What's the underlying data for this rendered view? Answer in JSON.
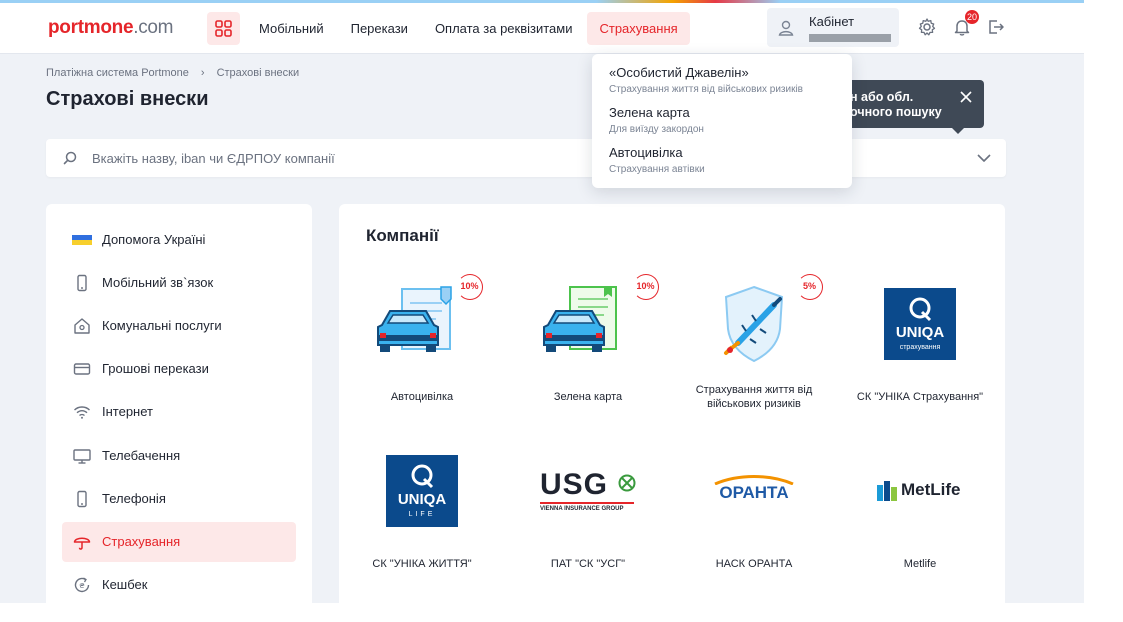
{
  "brand": {
    "logo_part1": "portmone",
    "logo_part2": ".com"
  },
  "nav": {
    "items": [
      "Мобільний",
      "Перекази",
      "Оплата за реквізитами",
      "Страхування"
    ],
    "active_index": 3
  },
  "header": {
    "cabinet_label": "Кабінет",
    "notifications_count": "20"
  },
  "breadcrumb": {
    "items": [
      "Платіжна система Portmone",
      "Страхові внески"
    ]
  },
  "page": {
    "title": "Страхові внески"
  },
  "search": {
    "placeholder": "Вкажіть назву, iban чи ЄДРПОУ компанії"
  },
  "tooltip": {
    "line1": "н або обл.",
    "line2": "очного пошуку"
  },
  "dropdown": {
    "items": [
      {
        "title": "«Особистий Джавелін»",
        "subtitle": "Страхування життя від військових ризиків"
      },
      {
        "title": "Зелена карта",
        "subtitle": "Для виїзду закордон"
      },
      {
        "title": "Автоцивілка",
        "subtitle": "Страхування автівки"
      }
    ]
  },
  "sidebar": {
    "items": [
      {
        "label": "Допомога Україні",
        "icon": "ukraine-flag-icon"
      },
      {
        "label": "Мобільний зв`язок",
        "icon": "mobile-icon"
      },
      {
        "label": "Комунальні послуги",
        "icon": "home-icon"
      },
      {
        "label": "Грошові перекази",
        "icon": "card-icon"
      },
      {
        "label": "Інтернет",
        "icon": "wifi-icon"
      },
      {
        "label": "Телебачення",
        "icon": "tv-icon"
      },
      {
        "label": "Телефонія",
        "icon": "phone-icon"
      },
      {
        "label": "Страхування",
        "icon": "umbrella-icon"
      },
      {
        "label": "Кешбек",
        "icon": "cashback-icon"
      }
    ],
    "active_index": 7
  },
  "main": {
    "title": "Компанії",
    "companies": [
      {
        "name": "Автоцивілка",
        "discount": "10%",
        "logo": "car-document"
      },
      {
        "name": "Зелена карта",
        "discount": "10%",
        "logo": "car-green-card"
      },
      {
        "name": "Страхування життя від військових ризиків",
        "discount": "5%",
        "logo": "shield-javelin"
      },
      {
        "name": "СК \"УНІКА Страхування\"",
        "logo_text": "UNIQA",
        "logo_sub": "страхування"
      },
      {
        "name": "СК \"УНІКА ЖИТТЯ\"",
        "logo_text": "UNIQA",
        "logo_sub": "LIFE"
      },
      {
        "name": "ПАТ \"СК \"УСГ\"",
        "logo_text": "USG",
        "logo_sub": "VIENNA INSURANCE GROUP"
      },
      {
        "name": "НАСК ОРАНТА",
        "logo_text": "ОРАНТА"
      },
      {
        "name": "Metlife",
        "logo_text": "MetLife"
      }
    ]
  },
  "colors": {
    "accent": "#e5252a",
    "accent_bg": "#fde8e8",
    "page_bg": "#eff2f7",
    "uniqa_blue": "#0b4a8c",
    "oranta_blue": "#1f5aa6",
    "oranta_orange": "#f39200",
    "usg_green": "#3a9a3e"
  }
}
